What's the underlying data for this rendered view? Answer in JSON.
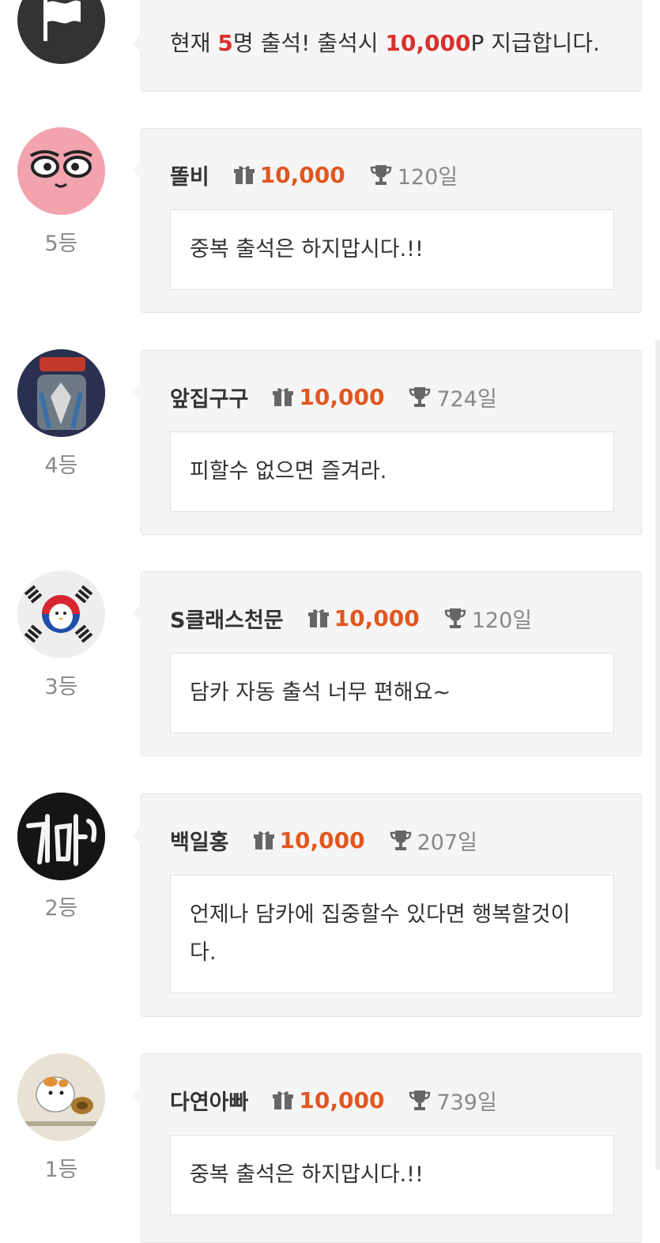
{
  "notice": {
    "prefix": "현재 ",
    "count": "5",
    "middle": "명 출석! 출석시 ",
    "points": "10,000",
    "suffix": "P 지급합니다."
  },
  "icons": {
    "flag": "flag-icon",
    "gift": "gift-icon",
    "trophy": "trophy-icon"
  },
  "colors": {
    "points": "#e2561f",
    "highlight": "#d9302c",
    "card_bg": "#f5f5f5"
  },
  "entries": [
    {
      "rank": "5등",
      "name": "똘비",
      "points": "10,000",
      "days": "120일",
      "message": "중복 출석은 하지맙시다.!!"
    },
    {
      "rank": "4등",
      "name": "앞집구구",
      "points": "10,000",
      "days": "724일",
      "message": "피할수 없으면 즐겨라."
    },
    {
      "rank": "3등",
      "name": "S클래스천문",
      "points": "10,000",
      "days": "120일",
      "message": "담카 자동 출석 너무 편해요~"
    },
    {
      "rank": "2등",
      "name": "백일홍",
      "points": "10,000",
      "days": "207일",
      "message": "언제나 담카에 집중할수 있다면 행복할것이다."
    },
    {
      "rank": "1등",
      "name": "다연아빠",
      "points": "10,000",
      "days": "739일",
      "message": "중복 출석은 하지맙시다.!!"
    }
  ]
}
